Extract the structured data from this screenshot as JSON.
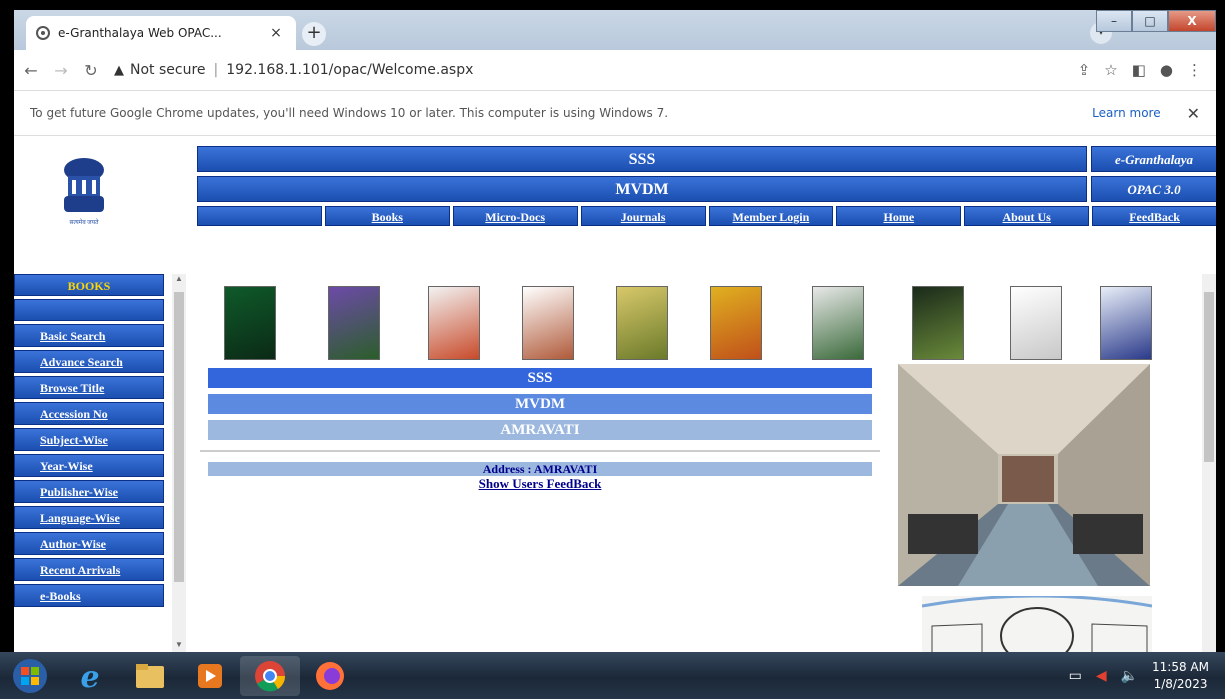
{
  "browser": {
    "tab_title": "e-Granthalaya Web OPAC...",
    "tab_close": "×",
    "new_tab": "+",
    "window_buttons": {
      "minimize": "–",
      "maximize": "□",
      "close": "X"
    },
    "security_label": "Not secure",
    "url": "192.168.1.101/opac/Welcome.aspx",
    "info_message": "To get future Google Chrome updates, you'll need Windows 10 or later. This computer is using Windows 7.",
    "learn_more": "Learn more",
    "info_close": "✕"
  },
  "header": {
    "line1": "SSS",
    "line2": "MVDM",
    "brand1": "e-Granthalaya",
    "brand2": "OPAC 3.0"
  },
  "topnav": [
    "Books",
    "Micro-Docs",
    "Journals",
    "Member Login",
    "Home",
    "About Us",
    "FeedBack"
  ],
  "sidebar": {
    "heading": "BOOKS",
    "items": [
      "Basic Search",
      "Advance Search",
      "Browse Title",
      "Accession No",
      "Subject-Wise",
      "Year-Wise",
      "Publisher-Wise",
      "Language-Wise",
      "Author-Wise",
      "Recent Arrivals",
      "e-Books"
    ]
  },
  "content": {
    "bar1": "SSS",
    "bar2": "MVDM",
    "bar3": "AMRAVATI",
    "address": "Address : AMRAVATI",
    "feedback_link": "Show Users FeedBack"
  },
  "colors": {
    "nav_blue": "#1b4fb0",
    "bar1": "#3366dd",
    "bar2": "#5b8ae0",
    "bar3": "#9db8df",
    "heading_gold": "#ffd700",
    "link_navy": "#00008b"
  },
  "taskbar": {
    "time": "11:58 AM",
    "date": "1/8/2023"
  }
}
